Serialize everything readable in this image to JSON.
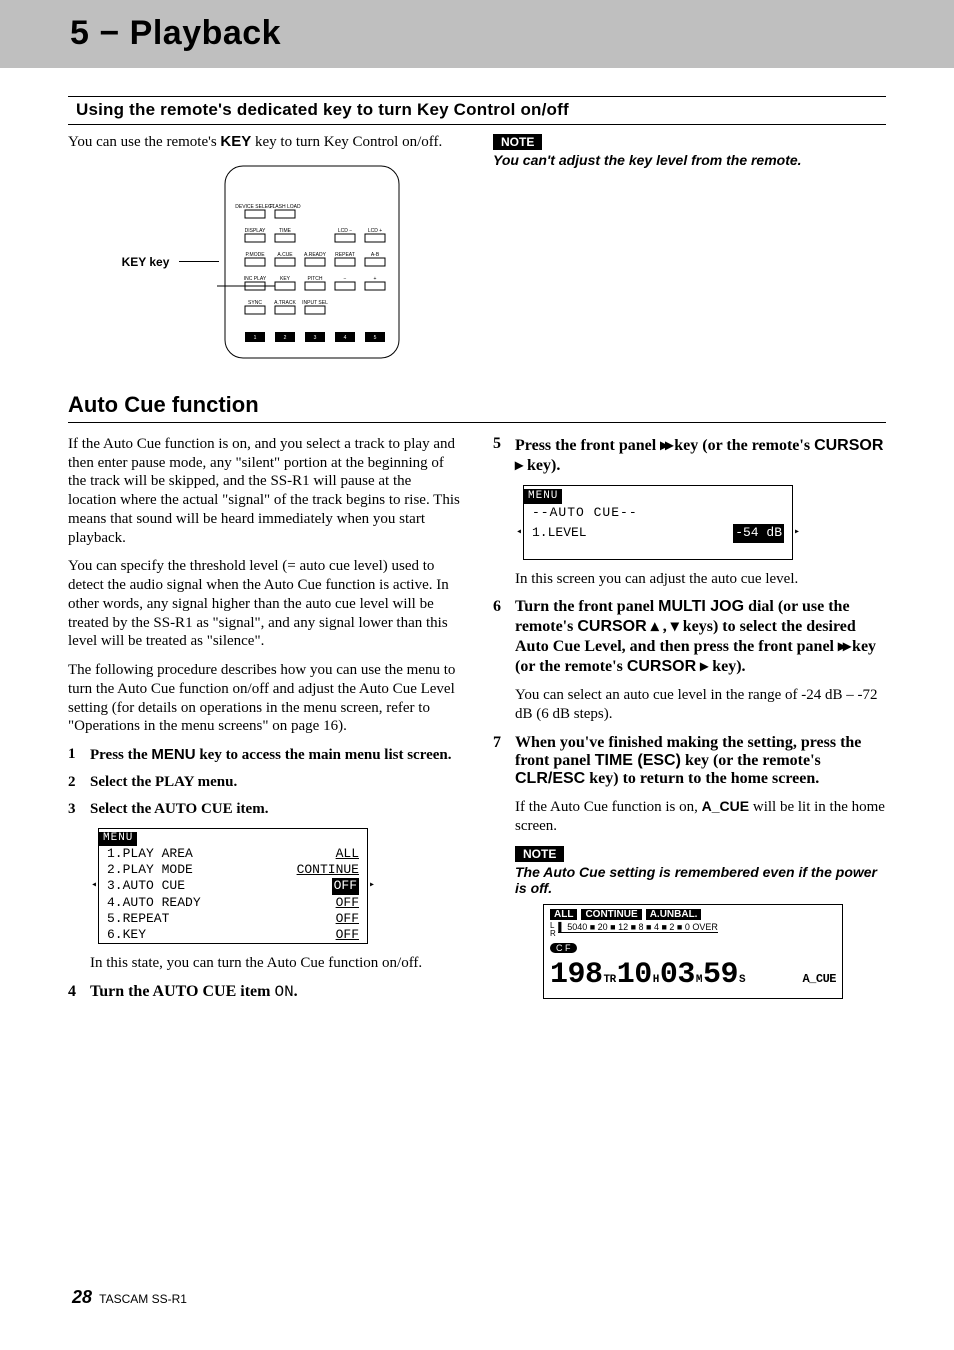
{
  "header": {
    "title": "5 − Playback"
  },
  "section1": {
    "heading": "Using the remote's dedicated key to turn Key Control on/off",
    "intro_pre": "You can use the remote's ",
    "intro_key": "KEY",
    "intro_post": " key to turn Key Control on/off.",
    "key_label": "KEY key",
    "note_label": "NOTE",
    "note_text": "You can't adjust the key level from the remote."
  },
  "remote_keys": {
    "r1": [
      "DEVICE SELECT",
      "FLASH LOAD"
    ],
    "r2": [
      "DISPLAY",
      "TIME",
      "",
      "LCD −",
      "LCD +"
    ],
    "r3": [
      "P.MODE",
      "A.CUE",
      "A.READY",
      "REPEAT",
      "A-B"
    ],
    "r4": [
      "INC PLAY",
      "KEY",
      "PITCH",
      "−",
      "+"
    ],
    "r5": [
      "SYNC",
      "A.TRACK",
      "INPUT SEL"
    ],
    "nums": [
      "1",
      "2",
      "3",
      "4",
      "5"
    ]
  },
  "section2": {
    "heading": "Auto Cue function",
    "p1": "If the Auto Cue function is on, and you select a track to play and then enter pause mode, any \"silent\" portion at the beginning of the track will be skipped, and the SS-R1 will pause at the location where the actual \"signal\" of the track begins to rise. This means that sound will be heard immediately when you start playback.",
    "p2": "You can specify the threshold level (= auto cue level) used to detect the audio signal when the Auto Cue function is active. In other words, any signal higher than the auto cue level will be treated by the SS-R1 as \"signal\", and any signal lower than this level will be treated as \"silence\".",
    "p3": "The following procedure describes how you can use the menu to turn the Auto Cue function on/off and adjust the Auto Cue Level setting (for details on operations in the menu screen, refer to \"Operations in the menu screens\" on page 16).",
    "steps_left": [
      {
        "n": "1",
        "bold_pre": "Press the ",
        "sans": "MENU",
        "bold_post": " key to access the main menu list screen."
      },
      {
        "n": "2",
        "bold_pre": "Select the PLAY menu.",
        "sans": "",
        "bold_post": ""
      },
      {
        "n": "3",
        "bold_pre": "Select the AUTO CUE item.",
        "sans": "",
        "bold_post": ""
      }
    ],
    "lcd1": {
      "head": "MENU",
      "rows": [
        {
          "l": "1.PLAY AREA",
          "r": "ALL",
          "sel": false
        },
        {
          "l": "2.PLAY MODE",
          "r": "CONTINUE",
          "sel": false
        },
        {
          "l": "3.AUTO CUE",
          "r": "OFF",
          "sel": true,
          "tick_l": true,
          "tick_r": true
        },
        {
          "l": "4.AUTO READY",
          "r": "OFF",
          "sel": false
        },
        {
          "l": "5.REPEAT",
          "r": "OFF",
          "sel": false
        },
        {
          "l": "6.KEY",
          "r": "OFF",
          "sel": false
        }
      ]
    },
    "after_lcd1": "In this state, you can turn the Auto Cue function on/off.",
    "step4_pre": "Turn the AUTO CUE item ",
    "step4_code": "ON",
    "step4_post": ".",
    "step5_pre": "Press the front panel ",
    "step5_glyph": "▸▸",
    "step5_mid": " key (or the remote's ",
    "step5_sans": "CURSOR",
    "step5_glyph2": " ▸",
    "step5_post": " key).",
    "lcd2": {
      "head": "MENU",
      "title": "--AUTO CUE--",
      "row_l": "1.LEVEL",
      "row_r": "-54 dB"
    },
    "after_lcd2": "In this screen you can adjust the auto cue level.",
    "step6_pre": "Turn the front panel ",
    "step6_sans1": "MULTI JOG",
    "step6_mid1": " dial (or use the remote's ",
    "step6_sans2": "CURSOR",
    "step6_glyphs": " ▴ ,  ▾ ",
    "step6_mid2": "keys) to select the desired Auto Cue Level, and then press the front panel ",
    "step6_glyph_ff": "▸▸",
    "step6_mid3": " key (or the remote's ",
    "step6_sans3": "CURSOR",
    "step6_glyph2": " ▸",
    "step6_post": " key).",
    "p_range": "You can select an auto cue level in the range of -24 dB – -72 dB (6 dB steps).",
    "step7_pre": "When you've finished making the setting, press the front panel ",
    "step7_sans1": "TIME (ESC)",
    "step7_mid": " key (or the remote's ",
    "step7_sans2": "CLR/ESC",
    "step7_post": " key) to return to the home screen.",
    "p_acue_pre": "If the Auto Cue function is on, ",
    "p_acue_sans": "A_CUE",
    "p_acue_post": " will be lit in the home screen.",
    "note2_label": "NOTE",
    "note2_text": "The Auto Cue setting is remembered even if the power is off.",
    "home": {
      "badges": [
        "ALL",
        "CONTINUE",
        "A.UNBAL."
      ],
      "scale_prefix": "L\nR",
      "scale": "5040 ■ 20 ■ 12 ■ 8 ■ 4 ■ 2 ■ 0 OVER",
      "cf": "C F",
      "track": "198",
      "track_u": "TR",
      "h": "10",
      "h_u": "H",
      "m": "03",
      "m_u": "M",
      "s": "59",
      "s_u": "S",
      "acue": "A_CUE"
    }
  },
  "footer": {
    "page": "28",
    "model": "TASCAM SS-R1"
  }
}
